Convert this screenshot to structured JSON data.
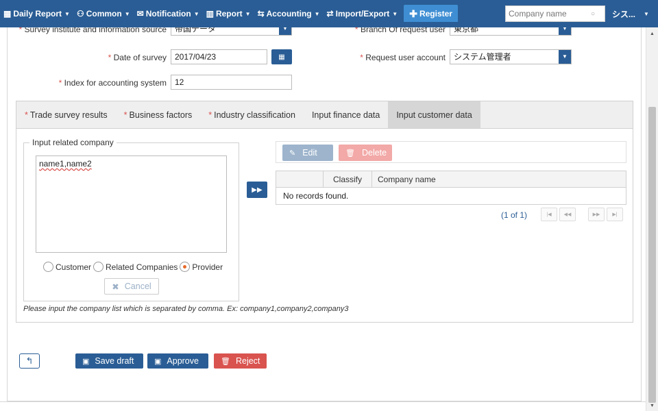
{
  "nav": {
    "items": [
      {
        "icon": "calendar-icon",
        "glyph": "▦",
        "label": "Daily Report"
      },
      {
        "icon": "users-icon",
        "glyph": "⚇",
        "label": "Common"
      },
      {
        "icon": "envelope-icon",
        "glyph": "✉",
        "label": "Notification"
      },
      {
        "icon": "chart-icon",
        "glyph": "▥",
        "label": "Report"
      },
      {
        "icon": "refresh-icon",
        "glyph": "⇆",
        "label": "Accounting"
      },
      {
        "icon": "exchange-icon",
        "glyph": "⇄",
        "label": "Import/Export"
      }
    ],
    "register_label": "Register",
    "search_placeholder": "Company name",
    "user_label": "シス..."
  },
  "form": {
    "survey_source_label": "Survey institute and information source",
    "survey_source_value": "帝国データ",
    "branch_label": "Branch Of request user",
    "branch_value": "東京都",
    "date_label": "Date of survey",
    "date_value": "2017/04/23",
    "request_account_label": "Request user account",
    "request_account_value": "システム管理者",
    "index_label": "Index for accounting system",
    "index_value": "12"
  },
  "tabs": [
    {
      "label": "Trade survey results",
      "required": true
    },
    {
      "label": "Business factors",
      "required": true
    },
    {
      "label": "Industry classification",
      "required": true
    },
    {
      "label": "Input finance data",
      "required": false
    },
    {
      "label": "Input customer data",
      "required": false,
      "active": true
    }
  ],
  "related": {
    "legend": "Input related company",
    "textarea_value": "name1,name2",
    "radios": [
      {
        "label": "Customer",
        "checked": false
      },
      {
        "label": "Related Companies",
        "checked": false
      },
      {
        "label": "Provider",
        "checked": true
      }
    ],
    "cancel_label": "Cancel",
    "hint": "Please input the company list which is separated by comma. Ex: company1,company2,company3"
  },
  "grid": {
    "edit_label": "Edit",
    "delete_label": "Delete",
    "columns": [
      "",
      "Classify",
      "Company name"
    ],
    "empty_message": "No records found.",
    "pager_info": "(1 of 1)"
  },
  "actions": {
    "save_draft": "Save draft",
    "approve": "Approve",
    "reject": "Reject"
  },
  "colors": {
    "primary": "#2a5d95",
    "danger": "#d9534f",
    "register": "#3f8ed3"
  }
}
